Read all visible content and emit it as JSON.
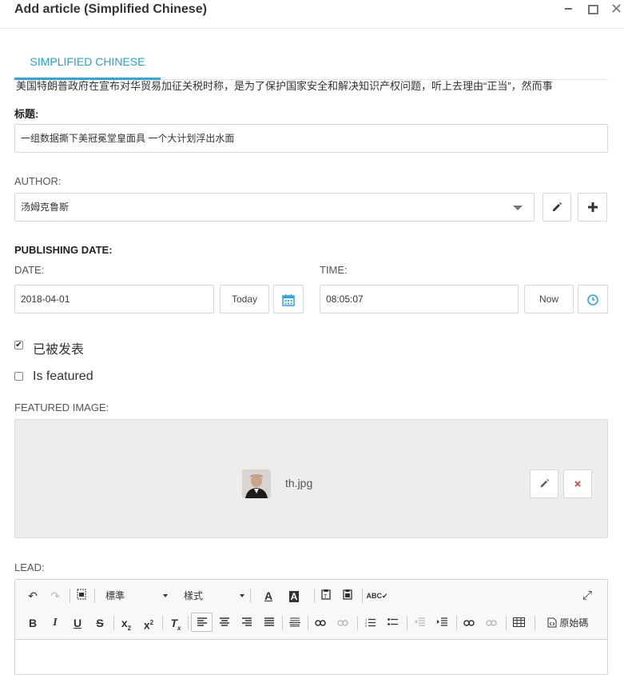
{
  "window": {
    "title": "Add article (Simplified Chinese)",
    "minimize_glyph": "−",
    "close_glyph": "✕"
  },
  "tabs": [
    {
      "label": "SIMPLIFIED CHINESE",
      "active": true
    }
  ],
  "title_field": {
    "label": "标题:",
    "value": "一组数据撕下美冠冕堂皇面具 一个大计划浮出水面"
  },
  "author": {
    "label": "AUTHOR:",
    "value": "汤姆克鲁斯",
    "edit_icon": "pencil-icon",
    "add_icon": "plus-icon"
  },
  "publishing": {
    "heading": "PUBLISHING DATE:",
    "date_label": "DATE:",
    "date_value": "2018-04-01",
    "today_label": "Today",
    "time_label": "TIME:",
    "time_value": "08:05:07",
    "now_label": "Now",
    "accent_color": "#2aa9e0"
  },
  "checkboxes": {
    "published_label": "已被发表",
    "published_checked": true,
    "featured_label": "Is featured",
    "featured_checked": false
  },
  "featured_image": {
    "label": "FEATURED IMAGE:",
    "filename": "th.jpg",
    "remove_color": "#d9534f"
  },
  "lead": {
    "label": "LEAD:",
    "format_select": "標準",
    "style_select": "樣式",
    "source_label": "原始碼",
    "body_text": "美国特朗普政府在宣布对华贸易加征关税时称，是为了保护国家安全和解决知识产权问题，听上去理由“正当”，然而事"
  }
}
